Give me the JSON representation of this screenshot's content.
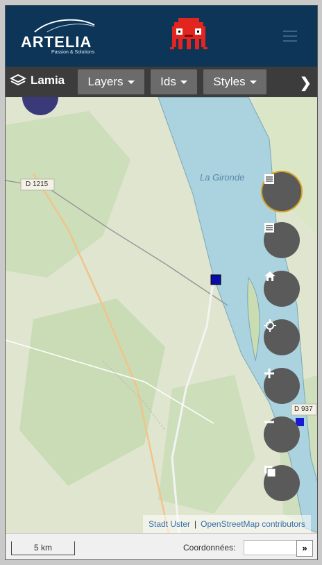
{
  "header": {
    "logo_name": "ARTELIA",
    "logo_tagline": "Passion & Solutions",
    "mascot_icon": "red-octopus-icon",
    "menu_icon": "hamburger-menu-icon"
  },
  "toolbar": {
    "brand_label": "Lamia",
    "brand_icon": "layers-stack-icon",
    "layers_label": "Layers",
    "ids_label": "Ids",
    "styles_label": "Styles",
    "next_icon": "chevron-right-icon"
  },
  "map": {
    "river_label": "La Gironde",
    "road_labels": [
      "D 1215",
      "D 937"
    ],
    "buttons": [
      {
        "name": "legend-button-1",
        "icon": "list-icon"
      },
      {
        "name": "legend-button-2",
        "icon": "list-icon"
      },
      {
        "name": "home-button",
        "icon": "home-icon"
      },
      {
        "name": "locate-button",
        "icon": "crosshair-icon"
      },
      {
        "name": "zoom-in-button",
        "icon": "plus-icon"
      },
      {
        "name": "zoom-out-button",
        "icon": "minus-icon"
      },
      {
        "name": "basemap-button",
        "icon": "layers-square-icon"
      }
    ],
    "attribution_1": "Stadt Uster",
    "attribution_sep": "|",
    "attribution_2": "OpenStreetMap contributors"
  },
  "footer": {
    "scale_label": "5 km",
    "coord_label": "Coordonnées:",
    "coord_value": "",
    "coord_go_label": "»"
  },
  "colors": {
    "header_bg": "#0d3557",
    "toolbar_bg": "#3c3c3c",
    "button_bg": "#6b6b6b",
    "map_button_bg": "#5a5a5a",
    "river": "#aad3df",
    "highlight": "#d8a020"
  }
}
